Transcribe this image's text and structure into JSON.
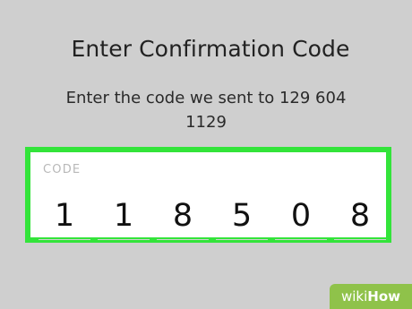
{
  "header": {
    "title": "Enter Confirmation Code",
    "subtitle_line1": "Enter the code we sent to  129  604",
    "subtitle_line2": "1129"
  },
  "code_field": {
    "label": "CODE",
    "digits": [
      "1",
      "1",
      "8",
      "5",
      "0",
      "8"
    ],
    "border_color": "#33e43a"
  },
  "watermark": {
    "part1": "wiki",
    "part2": "How",
    "color": "#8fc24a"
  }
}
